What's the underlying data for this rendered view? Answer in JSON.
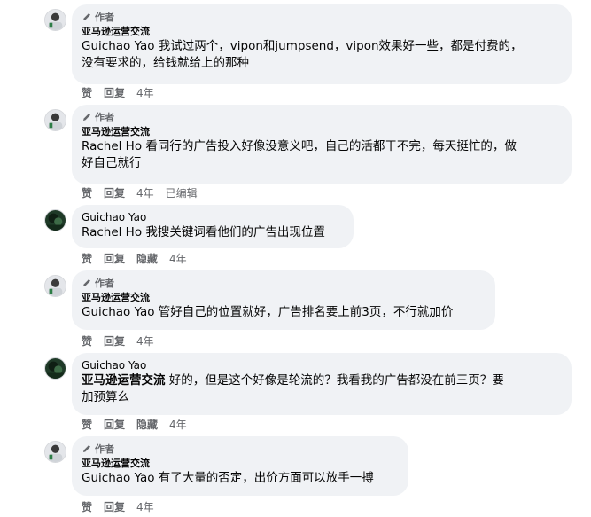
{
  "labels": {
    "author_badge": "作者",
    "like": "赞",
    "reply": "回复",
    "hide": "隐藏",
    "edited": "已编辑"
  },
  "comments": [
    {
      "group_name": "亚马逊运营交流",
      "mention": "Guichao Yao",
      "text": "我试过两个，vipon和jumpsend，vipon效果好一些，都是付费的，\n没有要求的，给钱就给上的那种",
      "time": "4年"
    },
    {
      "group_name": "亚马逊运营交流",
      "mention": "Rachel Ho",
      "text": "看同行的广告投入好像没意义吧，自己的活都干不完，每天挺忙的，做\n好自己就行",
      "time": "4年"
    },
    {
      "author": "Guichao Yao",
      "mention": "Rachel Ho",
      "text": "我搜关键词看他们的广告出现位置",
      "time": "4年"
    },
    {
      "group_name": "亚马逊运营交流",
      "mention": "Guichao Yao",
      "text": "管好自己的位置就好，广告排名要上前3页，不行就加价",
      "time": "4年"
    },
    {
      "author": "Guichao Yao",
      "mention": "亚马逊运营交流",
      "text": "好的，但是这个好像是轮流的？我看我的广告都没在前三页？要\n加预算么",
      "time": "4年"
    },
    {
      "group_name": "亚马逊运营交流",
      "mention": "Guichao Yao",
      "text": "有了大量的否定，出价方面可以放手一搏",
      "time": "4年"
    }
  ]
}
